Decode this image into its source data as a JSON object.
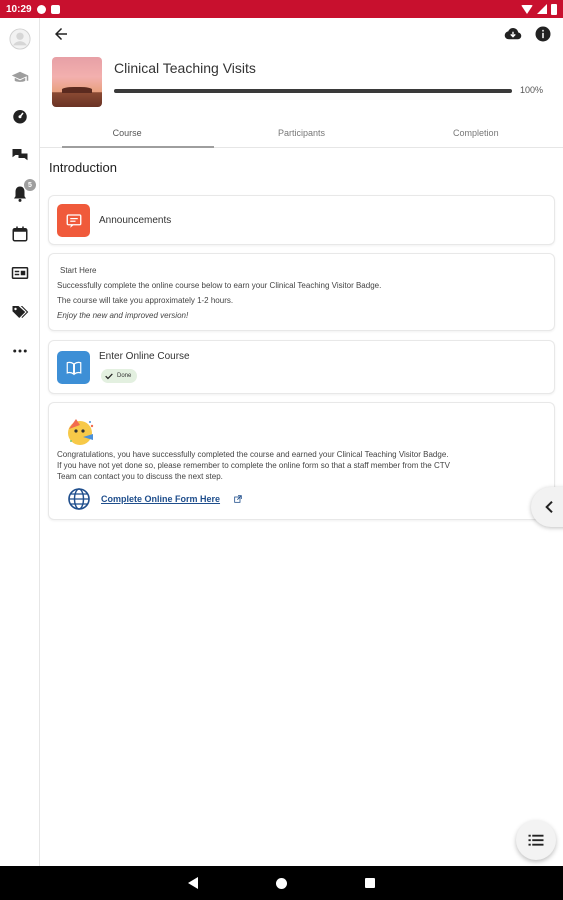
{
  "status_bar": {
    "time": "10:29"
  },
  "course": {
    "title": "Clinical Teaching Visits",
    "progress": 100,
    "progress_label": "100%"
  },
  "rail": {
    "notifications_badge": "5"
  },
  "tabs": [
    {
      "label": "Course",
      "active": true
    },
    {
      "label": "Participants",
      "active": false
    },
    {
      "label": "Completion",
      "active": false
    }
  ],
  "section": {
    "title": "Introduction"
  },
  "modules": {
    "announcements": {
      "label": "Announcements",
      "icon": "announcement-icon",
      "color": "#f05a3b"
    },
    "start_here": {
      "title": "Start Here",
      "line1": "Successfully complete the online course below to earn your Clinical Teaching Visitor Badge.",
      "line2": "The course will take you approximately 1-2 hours.",
      "line3": "Enjoy the new and improved version!"
    },
    "online_course": {
      "label": "Enter Online Course",
      "status": "Done",
      "icon": "book-icon",
      "color": "#3d8fd6"
    },
    "final": {
      "text1": "Congratulations, you have successfully completed the course and earned your Clinical Teaching Visitor Badge.",
      "text2": "If you have not yet done so, please remember to complete the online form so that a staff member from the CTV",
      "text3": "Team can contact you to discuss the next step.",
      "link": "Complete Online Form Here"
    }
  },
  "colors": {
    "status_bar": "#c8102e",
    "done_chip": "#e3f0e0",
    "link": "#1f4e8c"
  }
}
